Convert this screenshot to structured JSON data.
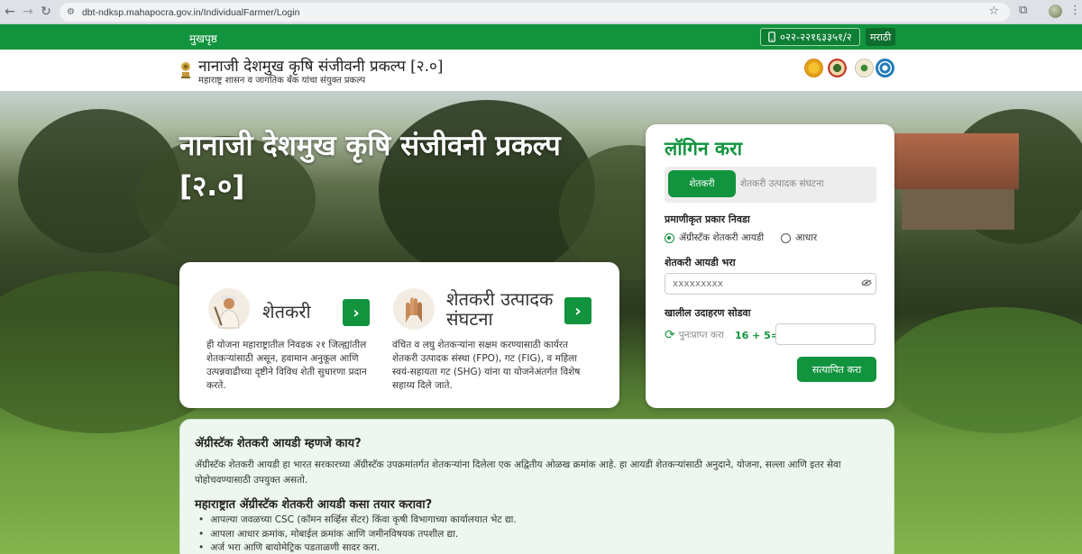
{
  "browser": {
    "url": "dbt-ndksp.mahapocra.gov.in/IndividualFarmer/Login"
  },
  "topbar": {
    "home": "मुखपृष्ठ",
    "phone": "०२२-२२१६३३५१/२",
    "language": "मराठी"
  },
  "header": {
    "title": "नानाजी देशमुख कृषि संजीवनी प्रकल्प [२.०]",
    "subtitle": "महाराष्ट्र शासन व जागतिक बँक यांचा संयुक्त प्रकल्प"
  },
  "hero": {
    "title": "नानाजी देशमुख कृषि संजीवनी प्रकल्प [२.०]"
  },
  "cards": [
    {
      "title": "शेतकरी",
      "description": "ही योजना महाराष्ट्रातील निवडक २१ जिल्ह्यांतील शेतकऱ्यांसाठी असून, हवामान अनुकूल आणि उत्पन्नवाढीच्या दृष्टीने विविध शेती सुधारणा प्रदान करते.",
      "icon": "farmer-icon"
    },
    {
      "title": "शेतकरी उत्पादक संघटना",
      "description": "वंचित व लघु शेतकऱ्यांना सक्षम करण्यासाठी कार्यरत शेतकरी उत्पादक संस्था (FPO), गट (FIG), व महिला स्वयं-सहायता गट (SHG) यांना या योजनेअंतर्गत विशेष सहाय्य दिले जाते.",
      "icon": "hands-icon"
    }
  ],
  "login": {
    "title": "लॉगिन करा",
    "tab_active": "शेतकरी",
    "tab_inactive": "शेतकरी उत्पादक संघटना",
    "auth_label": "प्रमाणीकृत प्रकार निवडा",
    "radio_agristack": "ॲग्रीस्टॅक शेतकरी आयडी",
    "radio_aadhar": "आधार",
    "selected_auth": "ॲग्रीस्टॅक शेतकरी आयडी",
    "id_label": "शेतकरी आयडी भरा",
    "id_placeholder": "xxxxxxxxx",
    "captcha_label": "खालील उदाहरण सोडवा",
    "refresh_text": "पुनःप्राप्त करा",
    "captcha_equation": "16 + 5=",
    "submit": "सत्यापित करा"
  },
  "info": {
    "title": "ॲग्रीस्टॅक शेतकरी आयडी म्हणजे काय?",
    "text": "ॲग्रीस्टॅक शेतकरी आयडी हा भारत सरकारच्या ॲग्रीस्टॅक उपक्रमांतर्गत शेतकऱ्यांना दिलेला एक अद्वितीय ओळख क्रमांक आहे. हा आयडी शेतकऱ्यांसाठी अनुदाने, योजना, सल्ला आणि इतर सेवा पोहोचवण्यासाठी उपयुक्त असतो.",
    "subtitle": "महाराष्ट्रात ॲग्रीस्टॅक शेतकरी आयडी कसा तयार करावा?",
    "steps": [
      "आपल्या जवळच्या CSC (कॉमन सर्व्हिस सेंटर) किंवा कृषी विभागाच्या कार्यालयात भेट द्या.",
      "आपला आधार क्रमांक, मोबाईल क्रमांक आणि जमीनविषयक तपशील द्या.",
      "अर्ज भरा आणि बायोमेट्रिक पडताळणी सादर करा."
    ]
  },
  "colors": {
    "primary_green": "#12933e"
  }
}
